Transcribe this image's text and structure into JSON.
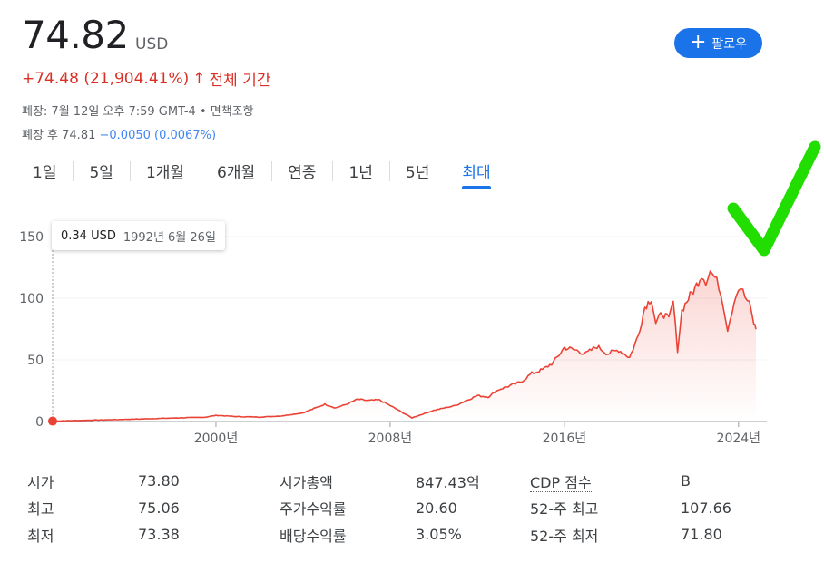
{
  "quote": {
    "price": "74.82",
    "currency": "USD",
    "change": "+74.48 (21,904.41%)",
    "change_arrow": "↑",
    "change_period": "전체 기간",
    "close_info": "폐장: 7월 12일 오후 7:59 GMT-4 • 면책조항",
    "after_hours_label": "폐장 후 74.81",
    "after_hours_change": "−0.0050 (0.0067%)"
  },
  "follow_button": {
    "icon": "plus-icon",
    "label": "팔로우"
  },
  "tabs": [
    {
      "label": "1일"
    },
    {
      "label": "5일"
    },
    {
      "label": "1개월"
    },
    {
      "label": "6개월"
    },
    {
      "label": "연중"
    },
    {
      "label": "1년"
    },
    {
      "label": "5년"
    },
    {
      "label": "최대",
      "active": true
    }
  ],
  "tooltip": {
    "value": "0.34 USD",
    "date": "1992년 6월 26일"
  },
  "chart_data": {
    "type": "area",
    "y_ticks": [
      "150",
      "100",
      "50",
      "0"
    ],
    "x_ticks": [
      "2000년",
      "2008년",
      "2016년",
      "2024년"
    ],
    "ylim": [
      0,
      150
    ],
    "xlim": [
      1992.5,
      2024.8
    ],
    "line_color": "#ea4335",
    "grid": true,
    "series": [
      {
        "points": [
          [
            1992.5,
            0.34
          ],
          [
            1994.0,
            1.0
          ],
          [
            1996.0,
            1.8
          ],
          [
            1998.0,
            2.8
          ],
          [
            1999.5,
            3.5
          ],
          [
            2000.0,
            5.0
          ],
          [
            2001.0,
            4.0
          ],
          [
            2002.0,
            3.6
          ],
          [
            2003.0,
            4.5
          ],
          [
            2004.0,
            7.0
          ],
          [
            2005.0,
            14.0
          ],
          [
            2005.5,
            11.0
          ],
          [
            2006.0,
            14.0
          ],
          [
            2006.5,
            18.0
          ],
          [
            2007.0,
            17.0
          ],
          [
            2007.5,
            17.5
          ],
          [
            2008.0,
            13.0
          ],
          [
            2008.5,
            8.0
          ],
          [
            2009.0,
            3.0
          ],
          [
            2009.5,
            6.0
          ],
          [
            2010.0,
            9.0
          ],
          [
            2011.0,
            13.0
          ],
          [
            2011.5,
            17.0
          ],
          [
            2012.0,
            21.0
          ],
          [
            2012.5,
            20.0
          ],
          [
            2013.0,
            26.0
          ],
          [
            2013.5,
            29.0
          ],
          [
            2014.0,
            32.0
          ],
          [
            2014.5,
            39.0
          ],
          [
            2015.0,
            42.0
          ],
          [
            2015.5,
            48.0
          ],
          [
            2016.0,
            60.0
          ],
          [
            2016.5,
            58.0
          ],
          [
            2017.0,
            55.0
          ],
          [
            2017.5,
            61.0
          ],
          [
            2018.0,
            55.0
          ],
          [
            2018.5,
            58.0
          ],
          [
            2019.0,
            52.0
          ],
          [
            2019.4,
            70.0
          ],
          [
            2019.7,
            93.0
          ],
          [
            2020.0,
            100.0
          ],
          [
            2020.2,
            80.0
          ],
          [
            2020.5,
            88.0
          ],
          [
            2020.8,
            83.0
          ],
          [
            2021.0,
            97.0
          ],
          [
            2021.2,
            58.0
          ],
          [
            2021.4,
            90.0
          ],
          [
            2021.7,
            100.0
          ],
          [
            2022.0,
            108.0
          ],
          [
            2022.3,
            119.0
          ],
          [
            2022.5,
            114.0
          ],
          [
            2022.7,
            122.0
          ],
          [
            2022.9,
            117.0
          ],
          [
            2023.1,
            110.0
          ],
          [
            2023.3,
            95.0
          ],
          [
            2023.5,
            75.0
          ],
          [
            2023.7,
            90.0
          ],
          [
            2023.9,
            105.0
          ],
          [
            2024.1,
            109.0
          ],
          [
            2024.3,
            101.0
          ],
          [
            2024.5,
            95.0
          ],
          [
            2024.7,
            80.0
          ],
          [
            2024.8,
            74.82
          ]
        ]
      }
    ]
  },
  "stats": [
    {
      "label": "시가",
      "value": "73.80"
    },
    {
      "label": "최고",
      "value": "75.06"
    },
    {
      "label": "최저",
      "value": "73.38"
    },
    {
      "label": "시가총액",
      "value": "847.43억"
    },
    {
      "label": "주가수익률",
      "value": "20.60"
    },
    {
      "label": "배당수익률",
      "value": "3.05%"
    },
    {
      "label": "CDP 점수",
      "value": "B"
    },
    {
      "label": "52-주 최고",
      "value": "107.66"
    },
    {
      "label": "52-주 최저",
      "value": "71.80"
    }
  ],
  "annotation": {
    "icon": "green-checkmark-icon",
    "color": "#22dd00"
  }
}
